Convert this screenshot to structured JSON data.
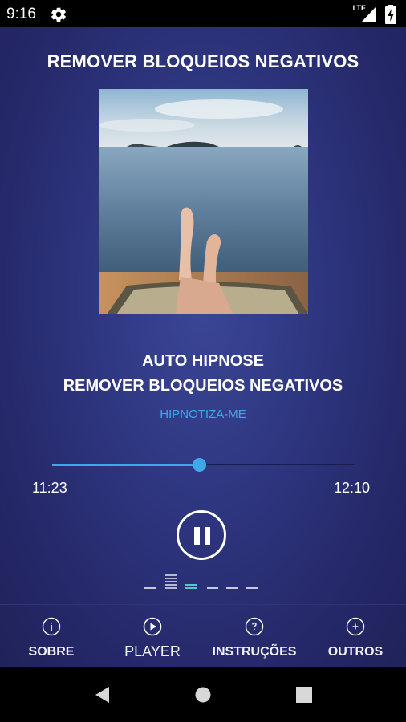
{
  "status_bar": {
    "time": "9:16",
    "network": "LTE",
    "icons": [
      "gear-icon",
      "signal-icon",
      "battery-charging-icon"
    ]
  },
  "player": {
    "title": "REMOVER BLOQUEIOS NEGATIVOS",
    "cover_image": "feet-on-lounger-facing-sea",
    "track_line1": "AUTO HIPNOSE",
    "track_line2": "REMOVER BLOQUEIOS NEGATIVOS",
    "artist": "HIPNOTIZA-ME",
    "elapsed": "11:23",
    "duration": "12:10",
    "progress": 0.484,
    "state": "playing",
    "pause_icon": "pause-icon",
    "accent_color": "#3fa9e8"
  },
  "equalizer": {
    "bars": [
      1,
      5,
      2,
      1,
      1,
      1
    ],
    "colors": [
      "#c9c9dc",
      "#b8b8d0",
      "#57c7c9",
      "#c9c9dc",
      "#c9c9dc",
      "#c9c9dc"
    ]
  },
  "bottom_nav": {
    "items": [
      {
        "label": "SOBRE",
        "icon": "info-icon"
      },
      {
        "label": "PLAYER",
        "icon": "play-circle-icon"
      },
      {
        "label": "INSTRUÇÕES",
        "icon": "help-icon"
      },
      {
        "label": "OUTROS",
        "icon": "plus-icon"
      }
    ],
    "active_index": 1
  },
  "system_nav": {
    "icons": [
      "back-icon",
      "home-icon",
      "recents-icon"
    ]
  }
}
